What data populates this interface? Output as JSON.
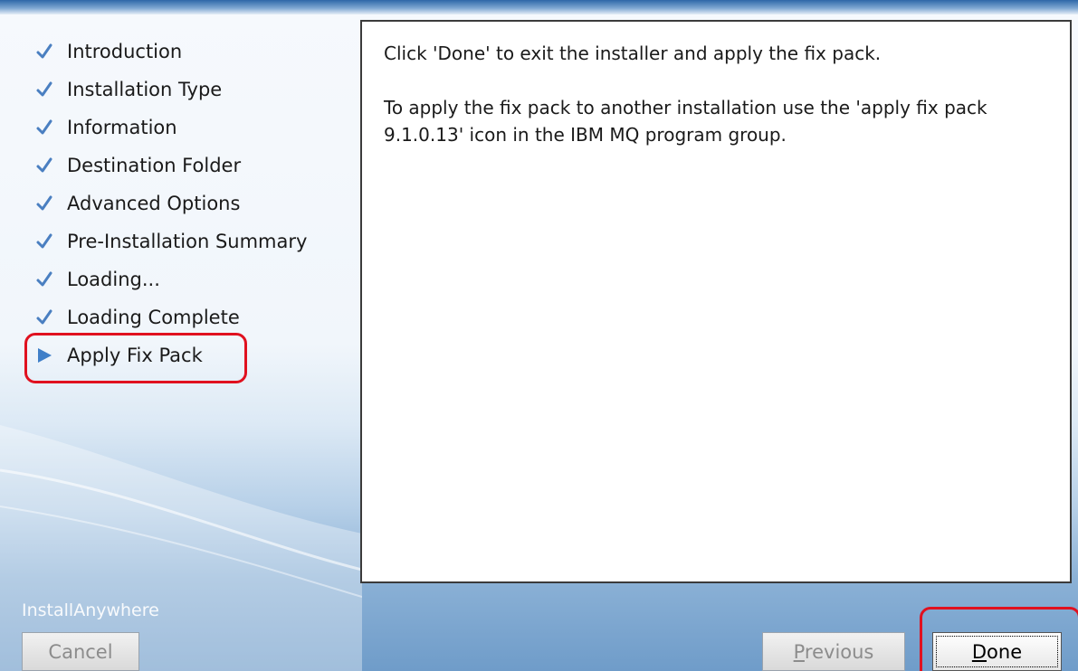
{
  "steps": [
    {
      "label": "Introduction",
      "state": "complete",
      "icon": "check-icon"
    },
    {
      "label": "Installation Type",
      "state": "complete",
      "icon": "check-icon"
    },
    {
      "label": "Information",
      "state": "complete",
      "icon": "check-icon"
    },
    {
      "label": "Destination Folder",
      "state": "complete",
      "icon": "check-icon"
    },
    {
      "label": "Advanced Options",
      "state": "complete",
      "icon": "check-icon"
    },
    {
      "label": "Pre-Installation Summary",
      "state": "complete",
      "icon": "check-icon"
    },
    {
      "label": "Loading...",
      "state": "complete",
      "icon": "check-icon"
    },
    {
      "label": "Loading Complete",
      "state": "complete",
      "icon": "check-icon"
    },
    {
      "label": "Apply Fix Pack",
      "state": "current",
      "icon": "current-step-arrow-icon"
    }
  ],
  "content": {
    "message_1": "Click 'Done' to exit the installer and apply the fix pack.",
    "message_2": "To apply the fix pack to another installation use the 'apply fix pack 9.1.0.13' icon in the IBM MQ program group."
  },
  "footer": {
    "brand": "InstallAnywhere",
    "cancel_label": "Cancel",
    "previous_mnemonic": "P",
    "previous_rest": "revious",
    "done_mnemonic": "D",
    "done_rest": "one"
  },
  "colors": {
    "check": "#4a7fc1",
    "arrow": "#3f7fc8",
    "annotation_red": "#e0111f"
  }
}
